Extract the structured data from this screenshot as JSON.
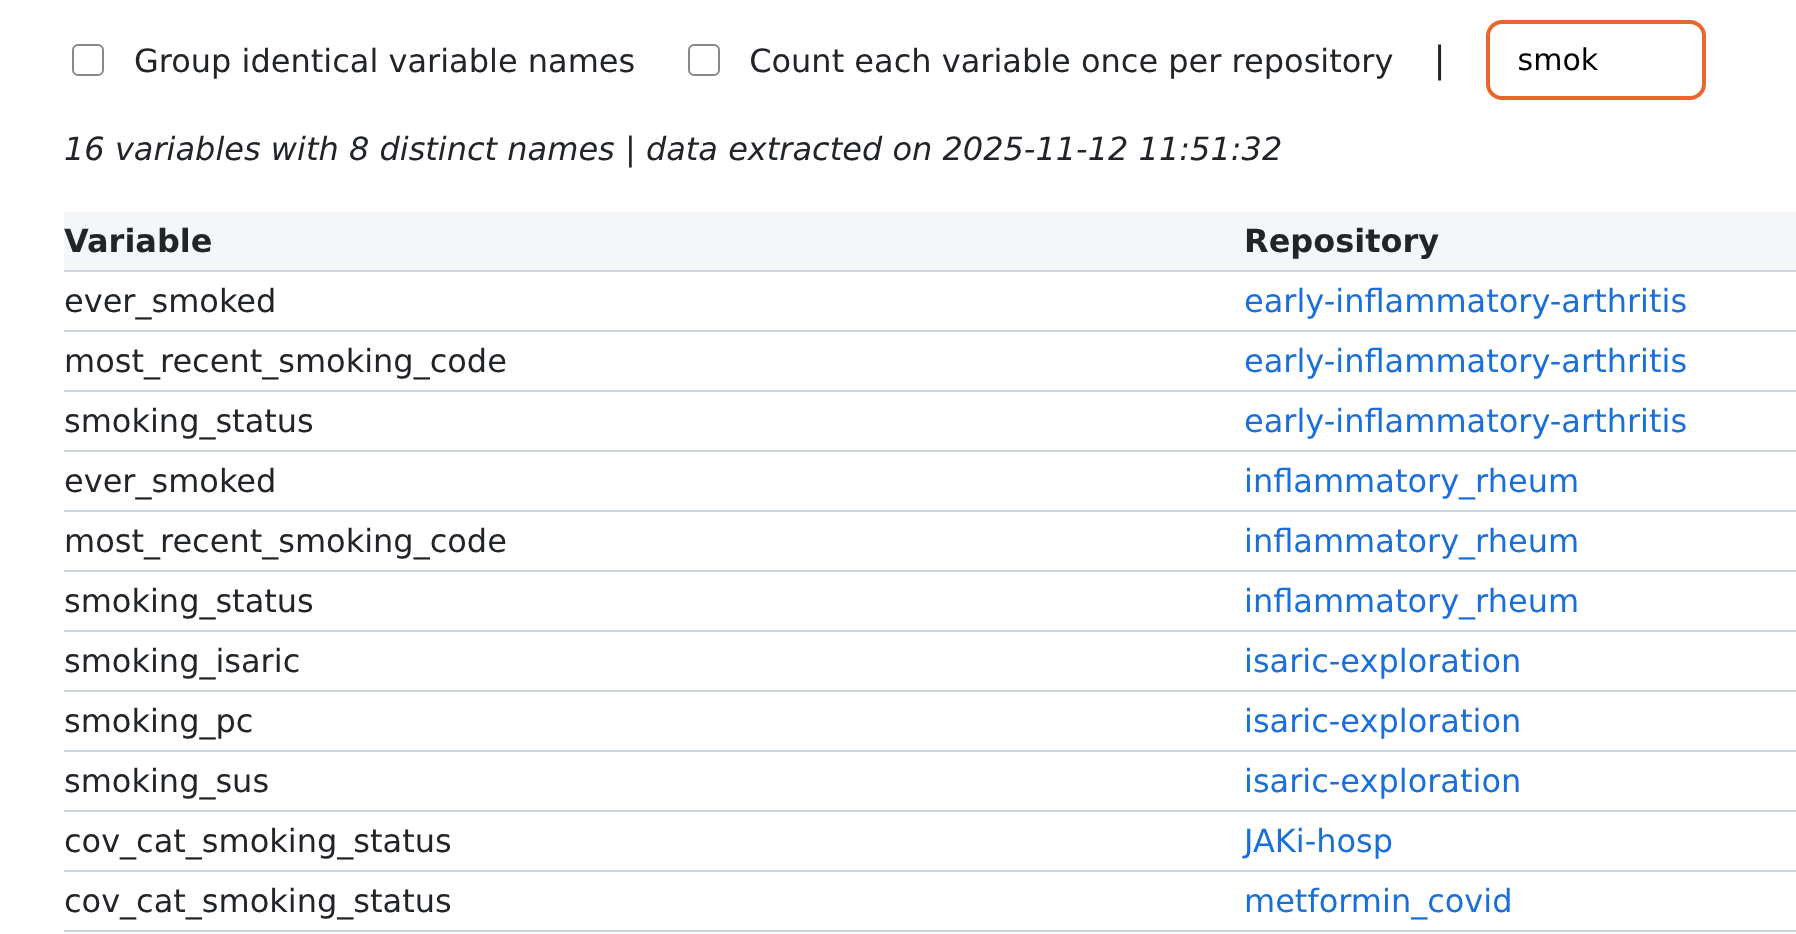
{
  "options": [
    {
      "label": "Group identical variable names",
      "checked": false
    },
    {
      "label": "Count each variable once per repository",
      "checked": false
    }
  ],
  "separator": "|",
  "search": {
    "value": "smok"
  },
  "summary": "16 variables with 8 distinct names | data extracted on 2025-11-12 11:51:32",
  "table": {
    "columns": [
      "Variable",
      "Repository"
    ],
    "rows": [
      [
        "ever_smoked",
        "early-inflammatory-arthritis"
      ],
      [
        "most_recent_smoking_code",
        "early-inflammatory-arthritis"
      ],
      [
        "smoking_status",
        "early-inflammatory-arthritis"
      ],
      [
        "ever_smoked",
        "inflammatory_rheum"
      ],
      [
        "most_recent_smoking_code",
        "inflammatory_rheum"
      ],
      [
        "smoking_status",
        "inflammatory_rheum"
      ],
      [
        "smoking_isaric",
        "isaric-exploration"
      ],
      [
        "smoking_pc",
        "isaric-exploration"
      ],
      [
        "smoking_sus",
        "isaric-exploration"
      ],
      [
        "cov_cat_smoking_status",
        "JAKi-hosp"
      ],
      [
        "cov_cat_smoking_status",
        "metformin_covid"
      ]
    ]
  }
}
